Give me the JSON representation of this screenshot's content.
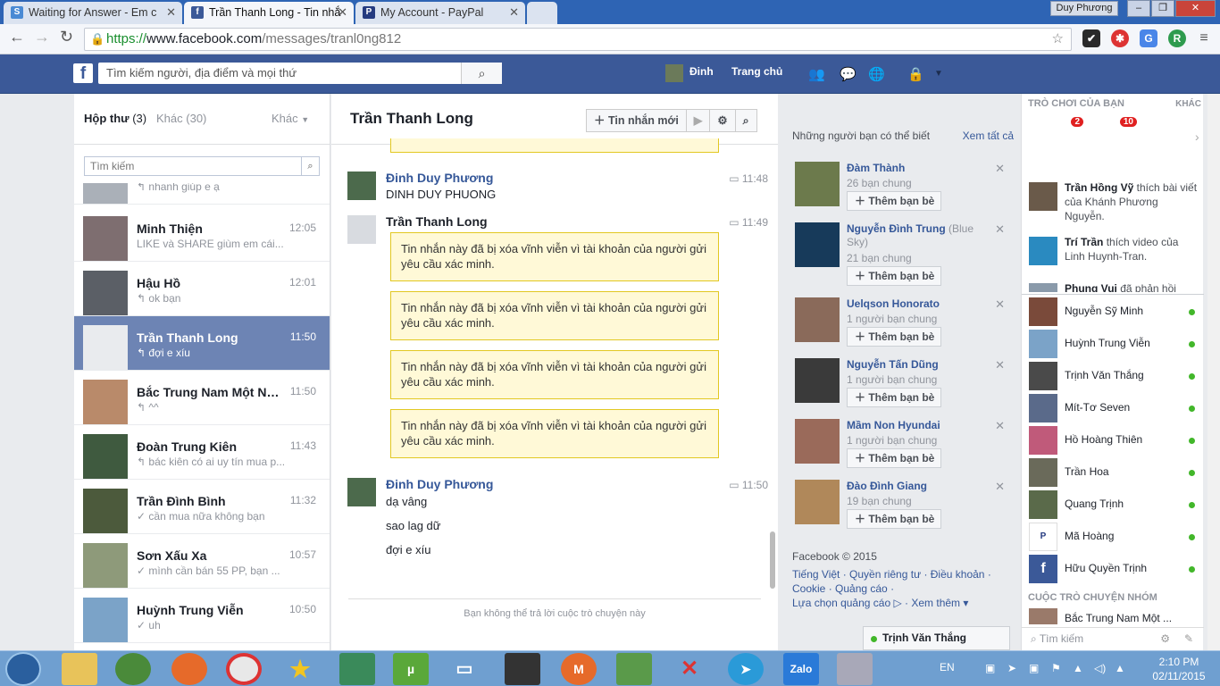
{
  "browser": {
    "tabs": [
      {
        "title": "Waiting for Answer - Em c",
        "icon": "S"
      },
      {
        "title": "Trần Thanh Long - Tin nhắ",
        "icon": "f"
      },
      {
        "title": "My Account - PayPal",
        "icon": "P"
      }
    ],
    "user": "Duy Phương",
    "url_scheme": "https://",
    "url_host": "www.facebook.com",
    "url_path": "/messages/tranl0ng812"
  },
  "fb": {
    "search_placeholder": "Tìm kiếm người, địa điểm và mọi thứ",
    "profile_name": "Đinh",
    "home": "Trang chủ"
  },
  "inbox": {
    "inbox_label": "Hộp thư",
    "inbox_count": "(3)",
    "other_label": "Khác",
    "other_count": "(30)",
    "more": "Khác",
    "search_placeholder": "Tìm kiếm",
    "conversations": [
      {
        "name": "",
        "time": "",
        "preview": "↰ nhanh giúp e ạ"
      },
      {
        "name": "Minh Thiện",
        "time": "12:05",
        "preview": "LIKE và SHARE giùm em cái..."
      },
      {
        "name": "Hậu Hồ",
        "time": "12:01",
        "preview": "↰ ok bạn"
      },
      {
        "name": "Trần Thanh Long",
        "time": "11:50",
        "preview": "↰ đợi e xíu"
      },
      {
        "name": "Bắc Trung Nam Một Nhà ...",
        "time": "11:50",
        "preview": "↰ ^^"
      },
      {
        "name": "Đoàn Trung Kiên",
        "time": "11:43",
        "preview": "↰ bác kiên có ai uy tín mua p..."
      },
      {
        "name": "Trần Đình Bình",
        "time": "11:32",
        "preview": "✓ cần mua nữa không bạn"
      },
      {
        "name": "Sơn Xấu Xa",
        "time": "10:57",
        "preview": "✓ mình cần bán 55 PP, bạn ..."
      },
      {
        "name": "Huỳnh Trung Viễn",
        "time": "10:50",
        "preview": "✓ uh"
      }
    ]
  },
  "chat": {
    "title": "Trần Thanh Long",
    "new_message": "Tin nhắn mới",
    "msg1": {
      "sender": "Đinh Duy Phương",
      "time": "11:48",
      "text": "DINH DUY PHUONG"
    },
    "msg2": {
      "sender": "Trần Thanh Long",
      "time": "11:49"
    },
    "deleted_text": "Tin nhắn này đã bị xóa vĩnh viễn vì tài khoản của người gửi yêu cầu xác minh.",
    "msg3": {
      "sender": "Đinh Duy Phương",
      "time": "11:50",
      "lines": [
        "dạ vâng",
        "sao lag dữ",
        "đợi e xíu"
      ]
    },
    "footer": "Bạn không thể trả lời cuộc trò chuyện này"
  },
  "suggest": {
    "title": "Những người bạn có thể biết",
    "see_all": "Xem tất cả",
    "add_label": "Thêm bạn bè",
    "people": [
      {
        "name": "Đàm Thành",
        "extra": "",
        "mutual": "26 bạn chung"
      },
      {
        "name": "Nguyễn Đình Trung",
        "extra": "(Blue Sky)",
        "mutual": "21 bạn chung"
      },
      {
        "name": "Uelqson Honorato",
        "extra": "",
        "mutual": "1 người bạn chung"
      },
      {
        "name": "Nguyễn Tấn Dũng",
        "extra": "",
        "mutual": "1 người bạn chung"
      },
      {
        "name": "Mầm Non Hyundai",
        "extra": "",
        "mutual": "1 người bạn chung"
      },
      {
        "name": "Đào Đình Giang",
        "extra": "",
        "mutual": "19 bạn chung"
      }
    ],
    "footer": {
      "copyright": "Facebook © 2015",
      "links1": "Tiếng Việt · Quyền riêng tư · Điều khoản ·",
      "links2": "Cookie · Quảng cáo ·",
      "links3": "Lựa chọn quảng cáo ▷ · Xem thêm ▾"
    }
  },
  "chat_tab": "Trịnh Văn Thắng",
  "right": {
    "games_title": "TRÒ CHƠI CỦA BẠN",
    "games_more": "KHÁC",
    "games": [
      {
        "label": "SALE",
        "count": "2",
        "color": "#e8a317"
      },
      {
        "label": "SALE",
        "count": "10",
        "color": "#d9437a"
      },
      {
        "label": "SALE",
        "count": "",
        "color": "#3aa0d8"
      }
    ],
    "ticker": [
      {
        "who": "Trần Hồng Vỹ",
        "what": " thích bài viết của Khánh Phương Nguyễn."
      },
      {
        "who": "Trí Trần",
        "what": " thích video của Linh Huynh-Tran."
      },
      {
        "who": "Phung Vui",
        "what": " đã phản hồi"
      }
    ],
    "friends": [
      "Nguyễn Sỹ Minh",
      "Huỳnh Trung Viễn",
      "Trịnh Văn Thắng",
      "Mít-Tơ Seven",
      "Hồ Hoàng Thiên",
      "Trần Hoa",
      "Quang Trịnh",
      "Mã Hoàng",
      "Hữu Quyền Trịnh"
    ],
    "group_title": "CUỘC TRÒ CHUYỆN NHÓM",
    "group_item": "Bắc Trung Nam Một ...",
    "search": "Tìm kiếm"
  },
  "taskbar": {
    "lang": "EN",
    "time": "2:10 PM",
    "date": "02/11/2015",
    "apps": [
      "explorer",
      "browser-green",
      "firefox",
      "chrome",
      "star",
      "network",
      "utorrent",
      "folder",
      "alien",
      "mega",
      "evernote",
      "x-app",
      "telegram",
      "Zalo",
      "calculator"
    ]
  }
}
